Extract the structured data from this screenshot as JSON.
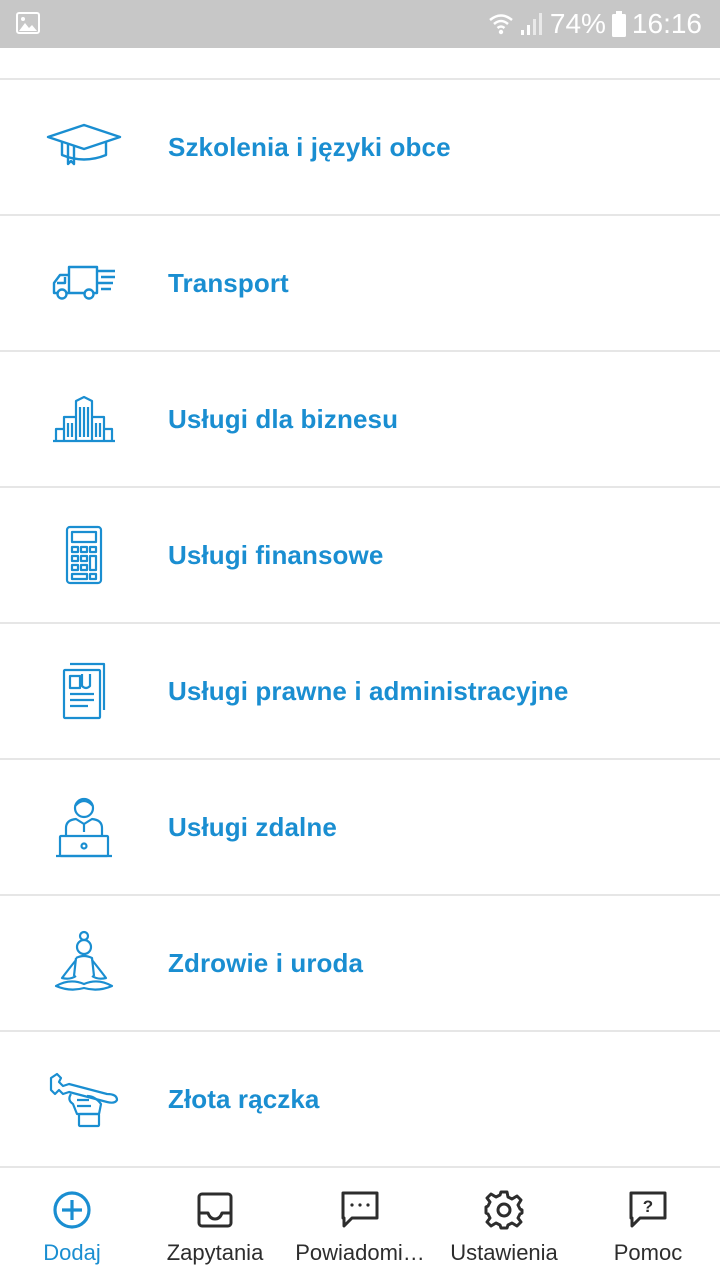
{
  "status_bar": {
    "battery": "74%",
    "time": "16:16"
  },
  "categories": [
    {
      "label": "Szkolenia i języki obce",
      "icon": "graduation-cap-icon"
    },
    {
      "label": "Transport",
      "icon": "delivery-truck-icon"
    },
    {
      "label": "Usługi dla biznesu",
      "icon": "buildings-icon"
    },
    {
      "label": "Usługi finansowe",
      "icon": "calculator-icon"
    },
    {
      "label": "Usługi prawne i administracyjne",
      "icon": "legal-documents-icon"
    },
    {
      "label": "Usługi zdalne",
      "icon": "remote-worker-icon"
    },
    {
      "label": "Zdrowie i uroda",
      "icon": "meditation-icon"
    },
    {
      "label": "Złota rączka",
      "icon": "wrench-hand-icon"
    }
  ],
  "bottom_nav": [
    {
      "label": "Dodaj",
      "icon": "plus-circle-icon",
      "active": true
    },
    {
      "label": "Zapytania",
      "icon": "inbox-icon",
      "active": false
    },
    {
      "label": "Powiadomi…",
      "icon": "chat-bubble-icon",
      "active": false
    },
    {
      "label": "Ustawienia",
      "icon": "gear-icon",
      "active": false
    },
    {
      "label": "Pomoc",
      "icon": "help-bubble-icon",
      "active": false
    }
  ],
  "colors": {
    "accent": "#1a8ed1",
    "status_bar": "#c7c7c7",
    "divider": "#e6e6e6"
  }
}
